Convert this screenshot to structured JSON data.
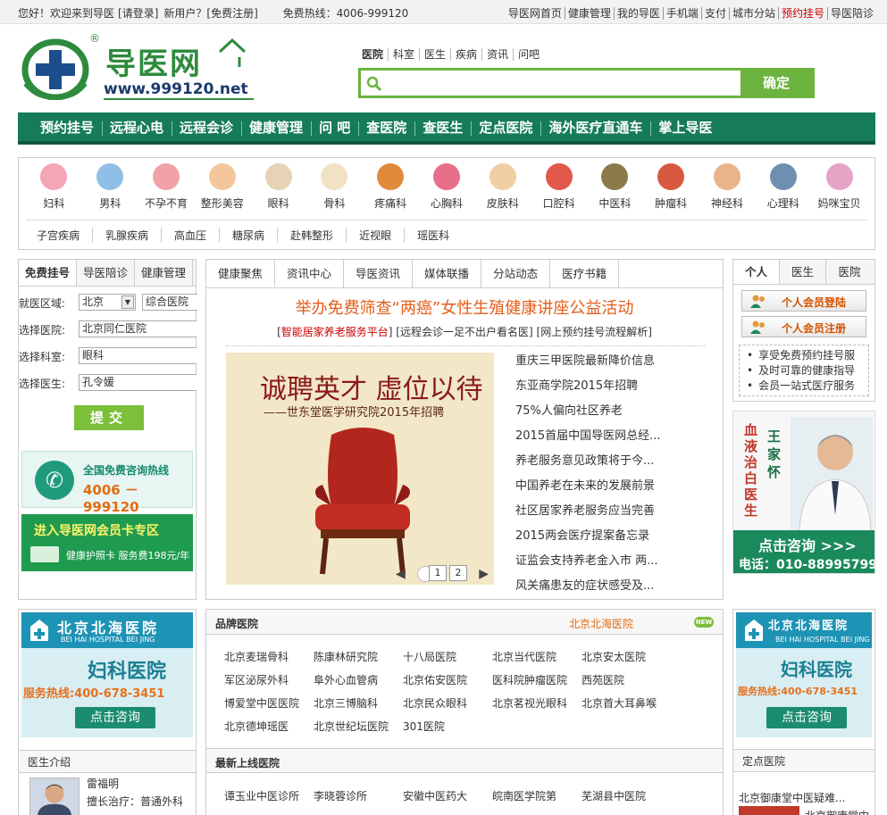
{
  "topbar": {
    "greeting": "您好！欢迎来到导医",
    "login": "[请登录]",
    "new_user": "新用户？",
    "register": "[免费注册]",
    "hotline": "免费热线：4006-999120",
    "links": [
      "导医网首页",
      "健康管理",
      "我的导医",
      "手机端",
      "支付",
      "城市分站",
      "预约挂号",
      "导医陪诊"
    ]
  },
  "logo": {
    "name": "导医网",
    "url": "www.999120.net",
    "reg": "®"
  },
  "search": {
    "tabs": [
      "医院",
      "科室",
      "医生",
      "疾病",
      "资讯",
      "问吧"
    ],
    "placeholder": "",
    "button": "确定"
  },
  "mainnav": [
    "预约挂号",
    "远程心电",
    "远程会诊",
    "健康管理",
    "问 吧",
    "查医院",
    "查医生",
    "定点医院",
    "海外医疗直通车",
    "掌上导医"
  ],
  "departments": [
    "妇科",
    "男科",
    "不孕不育",
    "整形美容",
    "眼科",
    "骨科",
    "疼痛科",
    "心胸科",
    "皮肤科",
    "口腔科",
    "中医科",
    "肿瘤科",
    "神经科",
    "心理科",
    "妈咪宝贝"
  ],
  "subdepartments": [
    "子宫疾病",
    "乳腺疾病",
    "高血压",
    "糖尿病",
    "赴韩整形",
    "近视眼",
    "瑶医科"
  ],
  "booking": {
    "tabs": [
      "免费挂号",
      "导医陪诊",
      "健康管理"
    ],
    "region_label": "就医区域:",
    "region_value": "北京",
    "hospital_type": "综合医院",
    "hospital_label": "选择医院:",
    "hospital_value": "北京同仁医院",
    "dept_label": "选择科室:",
    "dept_value": "眼科",
    "doctor_label": "选择医生:",
    "doctor_value": "孔令媛",
    "submit": "提交"
  },
  "ads_left": {
    "hotline_title": "全国免费咨询热线",
    "hotline_number": "4006 － 999120",
    "member_title": "进入导医网会员卡专区",
    "member_sub": "健康护照卡  服务费198元/年"
  },
  "news": {
    "tabs": [
      "健康聚焦",
      "资讯中心",
      "导医资讯",
      "媒体联播",
      "分站动态",
      "医疗书籍"
    ],
    "headline": "举办免费筛查“两癌”女性生殖健康讲座公益活动",
    "sublink1": "智能居家养老服务平台",
    "sublink2": "远程会诊一足不出户看名医",
    "sublink3": "网上预约挂号流程解析",
    "slide_title": "诚聘英才  虚位以待",
    "slide_sub": "——世东堂医学研究院2015年招聘",
    "pager": [
      "1",
      "2"
    ],
    "items": [
      "重庆三甲医院最新降价信息",
      "东亚商学院2015年招聘",
      "75%人偏向社区养老",
      "2015首届中国导医网总经...",
      "养老服务意见政策将于今...",
      "中国养老在未来的发展前景",
      "社区居家养老服务应当完善",
      "2015两会医疗提案备忘录",
      "证监会支持养老金入市 两...",
      "风关痛患友的症状感受及..."
    ]
  },
  "member": {
    "tabs": [
      "个人",
      "医生",
      "医院"
    ],
    "login": "个人会员登陆",
    "register": "个人会员注册",
    "perks": [
      "享受免费预约挂号服",
      "及时可靠的健康指导",
      "会员一站式医疗服务"
    ]
  },
  "doctor_ad": {
    "spec": "血液治白医生",
    "name": "王家怀",
    "cta": "点击咨询 >>>",
    "phone": "电话：010-88995799"
  },
  "hospital_ad": {
    "name": "北京北海医院",
    "en": "BEI HAI HOSPITAL BEI JING",
    "dept": "妇科医院",
    "hotline": "服务热线:400-678-3451",
    "cta": "点击咨询"
  },
  "left_lower": {
    "section": "医生介绍",
    "doctor_name": "雷福明",
    "specialty": "擅长治疗：普通外科"
  },
  "brand_hospitals": {
    "title": "品牌医院",
    "featured": "北京北海医院",
    "badge": "NEW",
    "items": [
      "北京麦瑞骨科",
      "陈康林研究院",
      "十八局医院",
      "北京当代医院",
      "北京安太医院",
      "军区泌尿外科",
      "阜外心血管病",
      "北京佑安医院",
      "医科院肿瘤医院",
      "西苑医院",
      "博爱堂中医医院",
      "北京三博脑科",
      "北京民众眼科",
      "北京茗视光眼科",
      "北京首大耳鼻喉",
      "北京德坤瑶医",
      "北京世纪坛医院",
      "301医院"
    ]
  },
  "new_hospitals": {
    "title": "最新上线医院",
    "items": [
      "谭玉业中医诊所",
      "李晓蓉诊所",
      "安徽中医药大",
      "皖南医学院第",
      "芜湖县中医院"
    ]
  },
  "right_lower": {
    "section": "定点医院",
    "item1": "北京御康堂中医疑难...",
    "item2": "北京御康堂中"
  }
}
